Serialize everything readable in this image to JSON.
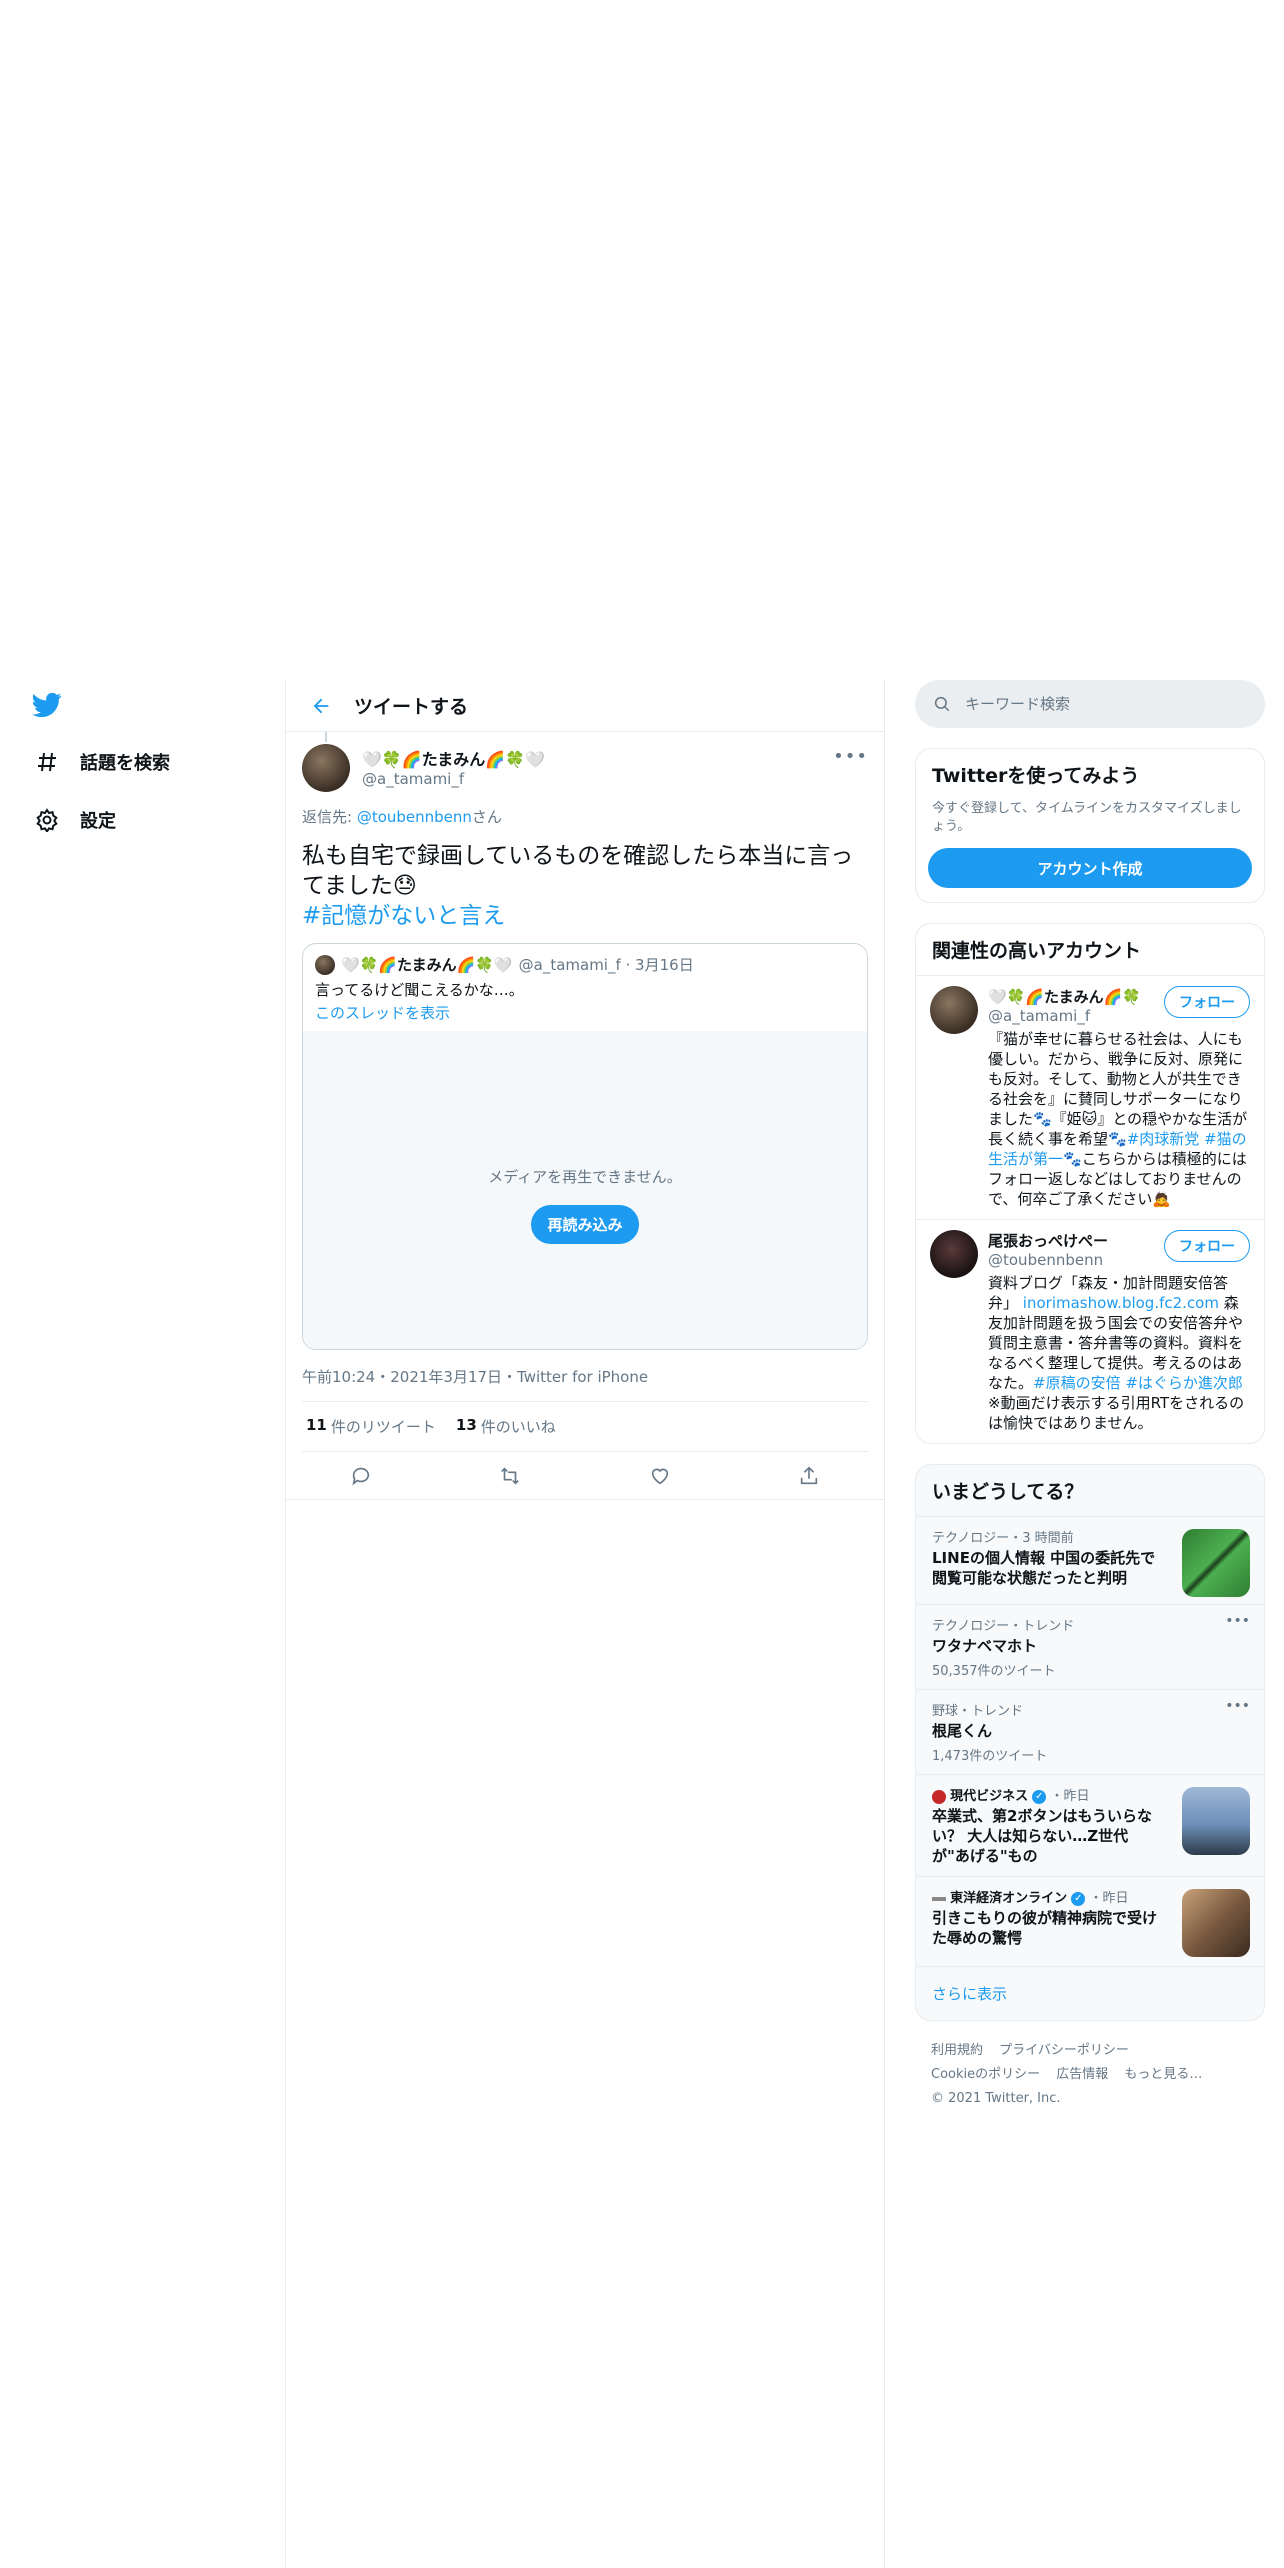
{
  "nav": {
    "items": [
      {
        "label": "話題を検索",
        "icon": "hashtag-icon"
      },
      {
        "label": "設定",
        "icon": "gear-icon"
      }
    ]
  },
  "header": {
    "title": "ツイートする"
  },
  "tweet": {
    "display_name": "🤍🍀🌈たまみん🌈🍀🤍",
    "handle": "@a_tamami_f",
    "reply_prefix": "返信先: ",
    "reply_handle": "@toubennbenn",
    "reply_suffix": "さん",
    "text": "私も自宅で録画しているものを確認したら本当に言ってました😓",
    "hashtag": "#記憶がないと言え",
    "timestamp": "午前10:24・2021年3月17日・Twitter for iPhone",
    "retweets": "11",
    "retweets_label": "件のリツイート",
    "likes": "13",
    "likes_label": "件のいいね"
  },
  "quote": {
    "display_name": "🤍🍀🌈たまみん🌈🍀🤍",
    "meta": "@a_tamami_f · 3月16日",
    "text": "言ってるけど聞こえるかな…。",
    "show_thread": "このスレッドを表示",
    "media_message": "メディアを再生できません。",
    "reload_label": "再読み込み"
  },
  "search": {
    "placeholder": "キーワード検索"
  },
  "signup": {
    "title": "Twitterを使ってみよう",
    "description": "今すぐ登録して、タイムラインをカスタマイズしましょう。",
    "button": "アカウント作成"
  },
  "related": {
    "title": "関連性の高いアカウント",
    "accounts": [
      {
        "name": "🤍🍀🌈たまみん🌈🍀",
        "handle": "@a_tamami_f",
        "follow": "フォロー",
        "bio_a": "『猫が幸せに暮らせる社会は、人にも優しい。だから、戦争に反対、原発にも反対。そして、動物と人が共生できる社会を』に賛同しサポーターになりました🐾『姫🐱』との穏やかな生活が長く続く事を希望🐾",
        "bio_tags": "#肉球新党 #猫の生活が第一",
        "bio_b": "🐾こちらからは積極的にはフォロー返しなどはしておりませんので、何卒ご了承ください🙇"
      },
      {
        "name": "尾張おっぺけぺー",
        "handle": "@toubennbenn",
        "follow": "フォロー",
        "bio_a": "資料ブログ「森友・加計問題安倍答弁」",
        "bio_link": "inorimashow.blog.fc2.com",
        "bio_b": "森友加計問題を扱う国会での安倍答弁や質問主意書・答弁書等の資料。資料をなるべく整理して提供。考えるのはあなた。",
        "bio_tags": "#原稿の安倍 #はぐらか進次郎",
        "bio_c": "※動画だけ表示する引用RTをされるのは愉快ではありません。"
      }
    ]
  },
  "trends": {
    "title": "いまどうしてる？",
    "items": [
      {
        "meta": "テクノロジー・3 時間前",
        "title": "LINEの個人情報 中国の委託先で閲覧可能な状態だったと判明",
        "count": "",
        "thumb": "line-thumbnail"
      },
      {
        "meta": "テクノロジー・トレンド",
        "title": "ワタナベマホト",
        "count": "50,357件のツイート"
      },
      {
        "meta": "野球・トレンド",
        "title": "根尾くん",
        "count": "1,473件のツイート"
      },
      {
        "source": "現代ビジネス",
        "meta": "・昨日",
        "title": "卒業式、第2ボタンはもういらない？ 大人は知らない…Z世代が\"あげる\"もの",
        "thumb": "graduation-thumbnail"
      },
      {
        "source": "東洋経済オンライン",
        "meta": "・昨日",
        "title": "引きこもりの彼が精神病院で受けた辱めの驚愕",
        "thumb": "hospital-thumbnail"
      }
    ],
    "show_more": "さらに表示"
  },
  "footer": {
    "links": [
      "利用規約",
      "プライバシーポリシー",
      "Cookieのポリシー",
      "広告情報",
      "もっと見る…"
    ],
    "copyright": "© 2021 Twitter, Inc."
  },
  "colors": {
    "accent": "#1d9bf0",
    "muted": "#657786",
    "border": "#e6ecf0"
  }
}
